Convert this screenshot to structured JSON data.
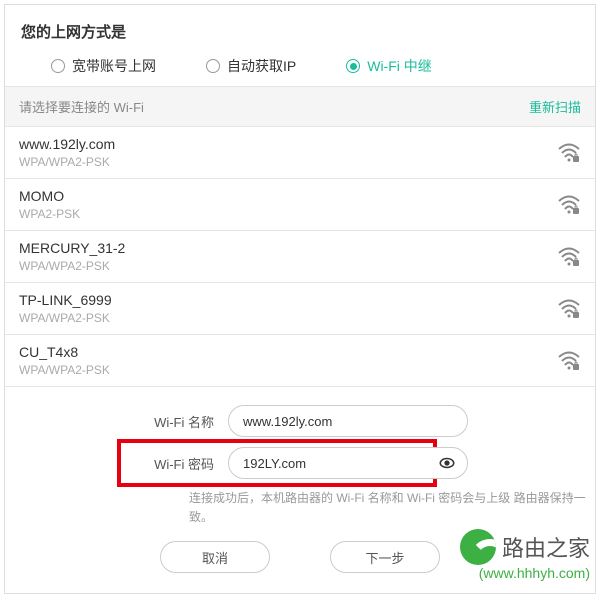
{
  "header": {
    "title": "您的上网方式是",
    "options": [
      "宽带账号上网",
      "自动获取IP",
      "Wi-Fi 中继"
    ],
    "selected_index": 2
  },
  "list_header": {
    "title": "请选择要连接的 Wi-Fi",
    "refresh": "重新扫描"
  },
  "wifi_list": [
    {
      "ssid": "www.192ly.com",
      "auth": "WPA/WPA2-PSK"
    },
    {
      "ssid": "MOMO",
      "auth": "WPA2-PSK"
    },
    {
      "ssid": "MERCURY_31-2",
      "auth": "WPA/WPA2-PSK"
    },
    {
      "ssid": "TP-LINK_6999",
      "auth": "WPA/WPA2-PSK"
    },
    {
      "ssid": "CU_T4x8",
      "auth": "WPA/WPA2-PSK"
    }
  ],
  "form": {
    "name_label": "Wi-Fi 名称",
    "name_value": "www.192ly.com",
    "pwd_label": "Wi-Fi 密码",
    "pwd_value": "192LY.com",
    "hint": "连接成功后，本机路由器的 Wi-Fi 名称和 Wi-Fi 密码会与上级\n路由器保持一致。"
  },
  "buttons": {
    "cancel": "取消",
    "next": "下一步"
  },
  "watermark": {
    "brand": "路由之家",
    "url": "(www.hhhyh.com)"
  }
}
